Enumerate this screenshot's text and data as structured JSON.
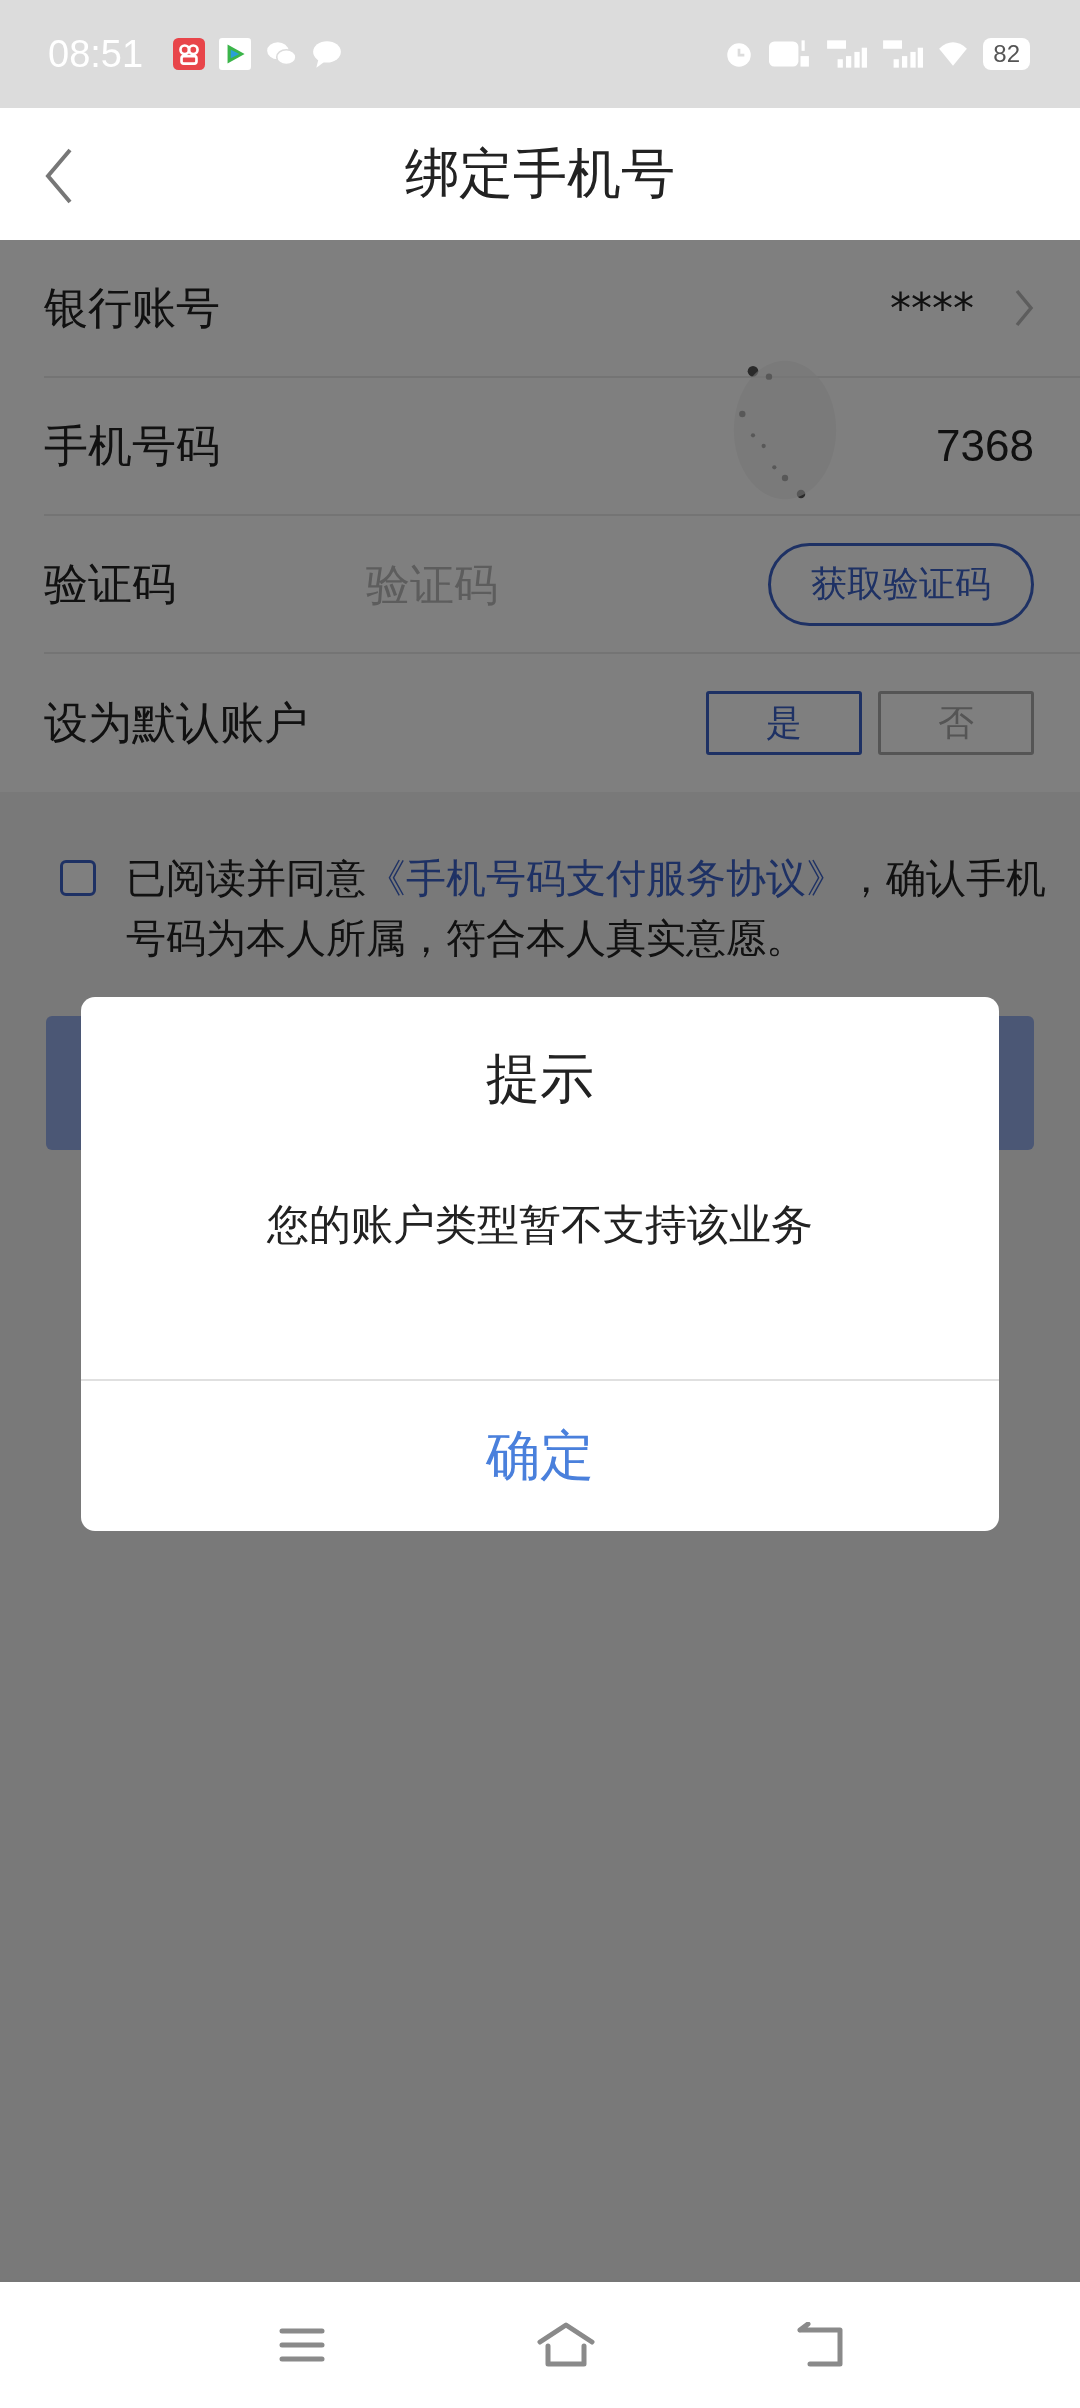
{
  "status_bar": {
    "time": "08:51",
    "battery": "82"
  },
  "header": {
    "title": "绑定手机号"
  },
  "form": {
    "rows": [
      {
        "kind": "link",
        "label": "银行账号",
        "value": "****"
      },
      {
        "kind": "value",
        "label": "手机号码",
        "value": "7368"
      },
      {
        "kind": "code",
        "label": "验证码",
        "placeholder": "验证码",
        "button": "获取验证码"
      },
      {
        "kind": "choice",
        "label": "设为默认账户",
        "options": [
          {
            "label": "是",
            "selected": true
          },
          {
            "label": "否",
            "selected": false
          }
        ]
      }
    ]
  },
  "agreement": {
    "checked": false,
    "text_before": "已阅读并同意",
    "link": "《手机号码支付服务协议》",
    "text_after": "，确认手机号码为本人所属，符合本人真实意愿。"
  },
  "dialog": {
    "title": "提示",
    "message": "您的账户类型暂不支持该业务",
    "button": "确定"
  }
}
